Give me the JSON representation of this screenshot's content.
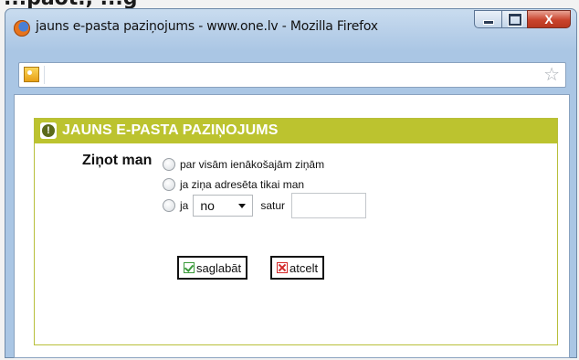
{
  "page_top_text": "...päot., ...g",
  "window": {
    "title": "jauns e-pasta paziņojums - www.one.lv - Mozilla Firefox",
    "buttons": {
      "minimize": "minimize",
      "maximize": "maximize",
      "close": "X"
    }
  },
  "addressbar": {
    "url": ""
  },
  "panel": {
    "title": "JAUNS E-PASTA PAZIŅOJUMS",
    "label": "Ziņot man",
    "options": [
      {
        "text": "par visām ienākošajām ziņām",
        "selected": false
      },
      {
        "text": "ja ziņa adresēta tikai man",
        "selected": false
      },
      {
        "text": "ja",
        "selected": false
      }
    ],
    "select_value": "no",
    "contains_label": "satur",
    "contains_value": ""
  },
  "buttons": {
    "save": "saglabāt",
    "cancel": "atcelt"
  }
}
